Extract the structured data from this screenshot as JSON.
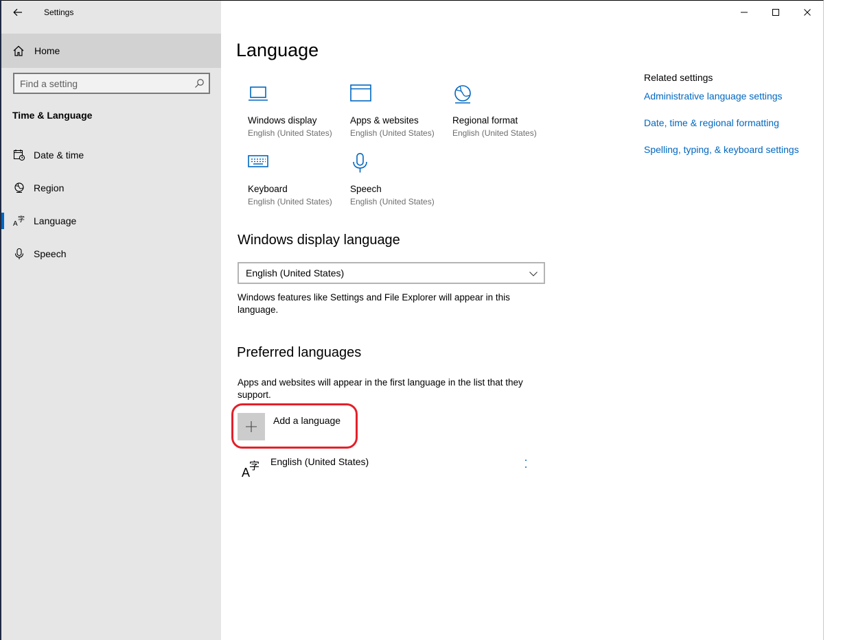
{
  "window": {
    "app_title": "Settings"
  },
  "sidebar": {
    "home_label": "Home",
    "search_placeholder": "Find a setting",
    "section_title": "Time & Language",
    "items": [
      {
        "label": "Date & time",
        "icon": "calendar-clock-icon"
      },
      {
        "label": "Region",
        "icon": "globe-icon"
      },
      {
        "label": "Language",
        "icon": "language-icon",
        "active": true
      },
      {
        "label": "Speech",
        "icon": "microphone-icon"
      }
    ]
  },
  "main": {
    "page_title": "Language",
    "tiles": [
      {
        "name": "Windows display",
        "sub": "English (United States)",
        "icon": "monitor-icon"
      },
      {
        "name": "Apps & websites",
        "sub": "English (United States)",
        "icon": "browser-window-icon"
      },
      {
        "name": "Regional format",
        "sub": "English (United States)",
        "icon": "globe-settings-icon"
      },
      {
        "name": "Keyboard",
        "sub": "English (United States)",
        "icon": "keyboard-icon"
      },
      {
        "name": "Speech",
        "sub": "English (United States)",
        "icon": "microphone-icon"
      }
    ],
    "display_language": {
      "heading": "Windows display language",
      "selected": "English (United States)",
      "description": "Windows features like Settings and File Explorer will appear in this language."
    },
    "preferred": {
      "heading": "Preferred languages",
      "description": "Apps and websites will appear in the first language in the list that they support.",
      "add_label": "Add a language",
      "languages": [
        {
          "label": "English (United States)"
        }
      ]
    }
  },
  "related": {
    "heading": "Related settings",
    "links": [
      "Administrative language settings",
      "Date, time & regional formatting",
      "Spelling, typing, & keyboard settings"
    ]
  },
  "colors": {
    "accent": "#0067c0",
    "highlight": "#e3202a",
    "sidebar_bg": "#e6e6e6"
  }
}
